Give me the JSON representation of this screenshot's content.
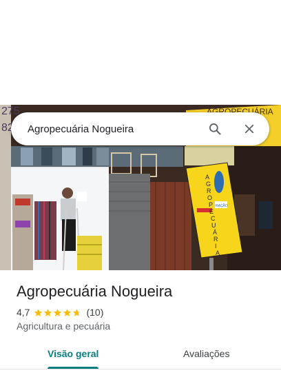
{
  "search": {
    "query": "Agropecuária Nogueira"
  },
  "place": {
    "name": "Agropecuária Nogueira",
    "rating": "4,7",
    "stars": 4.7,
    "review_count": "(10)",
    "category": "Agricultura e pecuária"
  },
  "photo": {
    "sign_vertical": [
      "A",
      "G",
      "R",
      "O",
      "P",
      "E",
      "C",
      "U",
      "Á",
      "R",
      "I",
      "A"
    ],
    "sign_name_label": "RAÇÃO",
    "banner_text": "AGROPECUÁRIA",
    "phone_fragment": "275",
    "phone_fragment_2": "82"
  },
  "tabs": {
    "overview": "Visão geral",
    "reviews": "Avaliações"
  },
  "colors": {
    "accent": "#0b7d81",
    "star": "#fbbc04",
    "star_empty": "#dadce0"
  },
  "icons": {
    "search": "search-icon",
    "close": "close-icon",
    "star": "star-icon"
  }
}
